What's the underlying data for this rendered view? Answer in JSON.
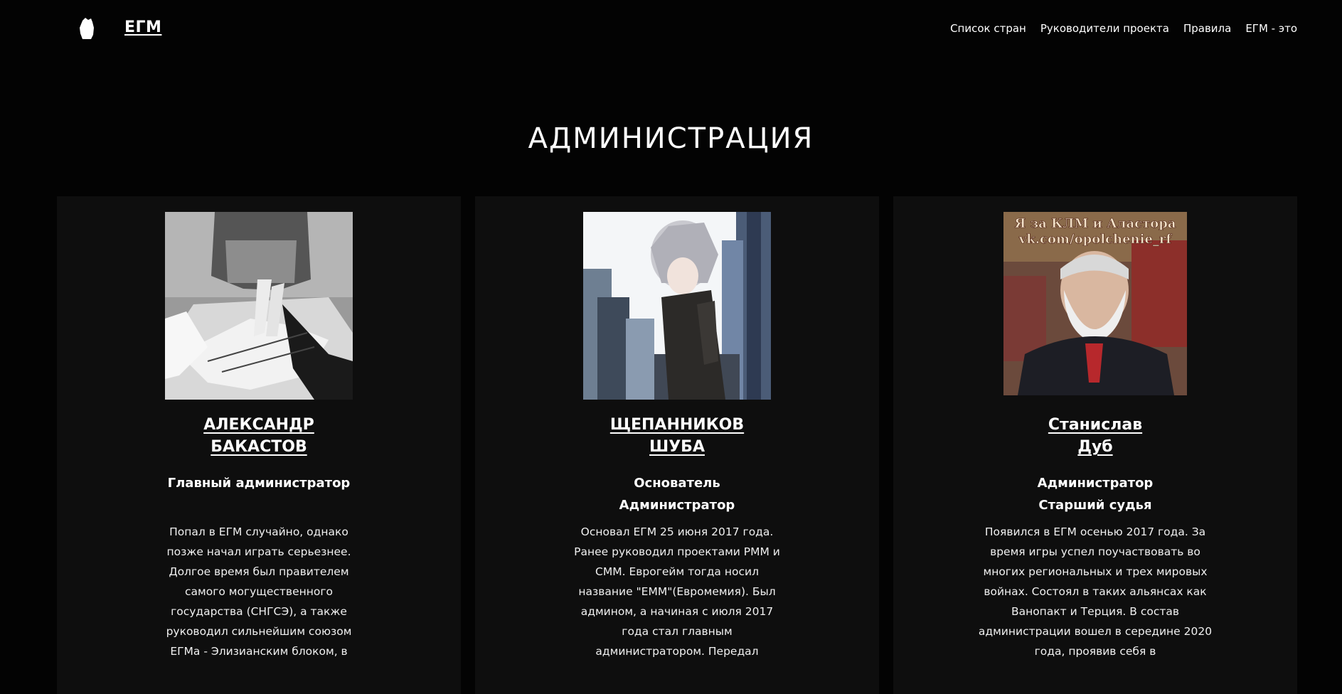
{
  "header": {
    "brand": "ЕГМ",
    "nav": [
      "Список стран",
      "Руководители проекта",
      "Правила",
      "ЕГМ - это"
    ]
  },
  "page": {
    "title": "АДМИНИСТРАЦИЯ"
  },
  "cards": [
    {
      "name_line1": "АЛЕКСАНДР",
      "name_line2": "БАКАСТОВ",
      "roles": [
        "Главный администратор"
      ],
      "bio": "Попал в ЕГМ случайно, однако позже начал играть серьезнее. Долгое время был правителем самого могущественного государства (СНГСЭ), а также руководил сильнейшим союзом ЕГМа - Элизианским блоком, в",
      "avatar_icon": "manga-portrait-image"
    },
    {
      "name_line1": "ЩЕПАННИКОВ",
      "name_line2": "ШУБА",
      "roles": [
        "Основатель",
        "Администратор"
      ],
      "bio": "Основал ЕГМ 25 июня 2017 года. Ранее руководил проектами РММ и СММ. Еврогейм тогда носил название \"ЕММ\"(Евромемия). Был админом, а начиная с июля 2017 года стал главным администратором. Передал",
      "avatar_icon": "anime-city-image"
    },
    {
      "name_line1": "Станислав",
      "name_line2": "Дуб",
      "roles": [
        "Администратор",
        "Старший судья"
      ],
      "bio": "Появился в ЕГМ осенью 2017 года. За время игры успел поучаствовать во многих региональных и трех мировых войнах. Состоял в таких альянсах как Ванопакт и Терция. В состав администрации вошел в середине 2020 года, проявив себя в",
      "avatar_icon": "old-man-photo-image",
      "avatar_caption_1": "Я за КЛМ и Аластора",
      "avatar_caption_2": "vk.com/opolchenie_rf"
    }
  ],
  "colors": {
    "background": "#030303",
    "card": "#0e0e0e",
    "text": "#ffffff"
  }
}
